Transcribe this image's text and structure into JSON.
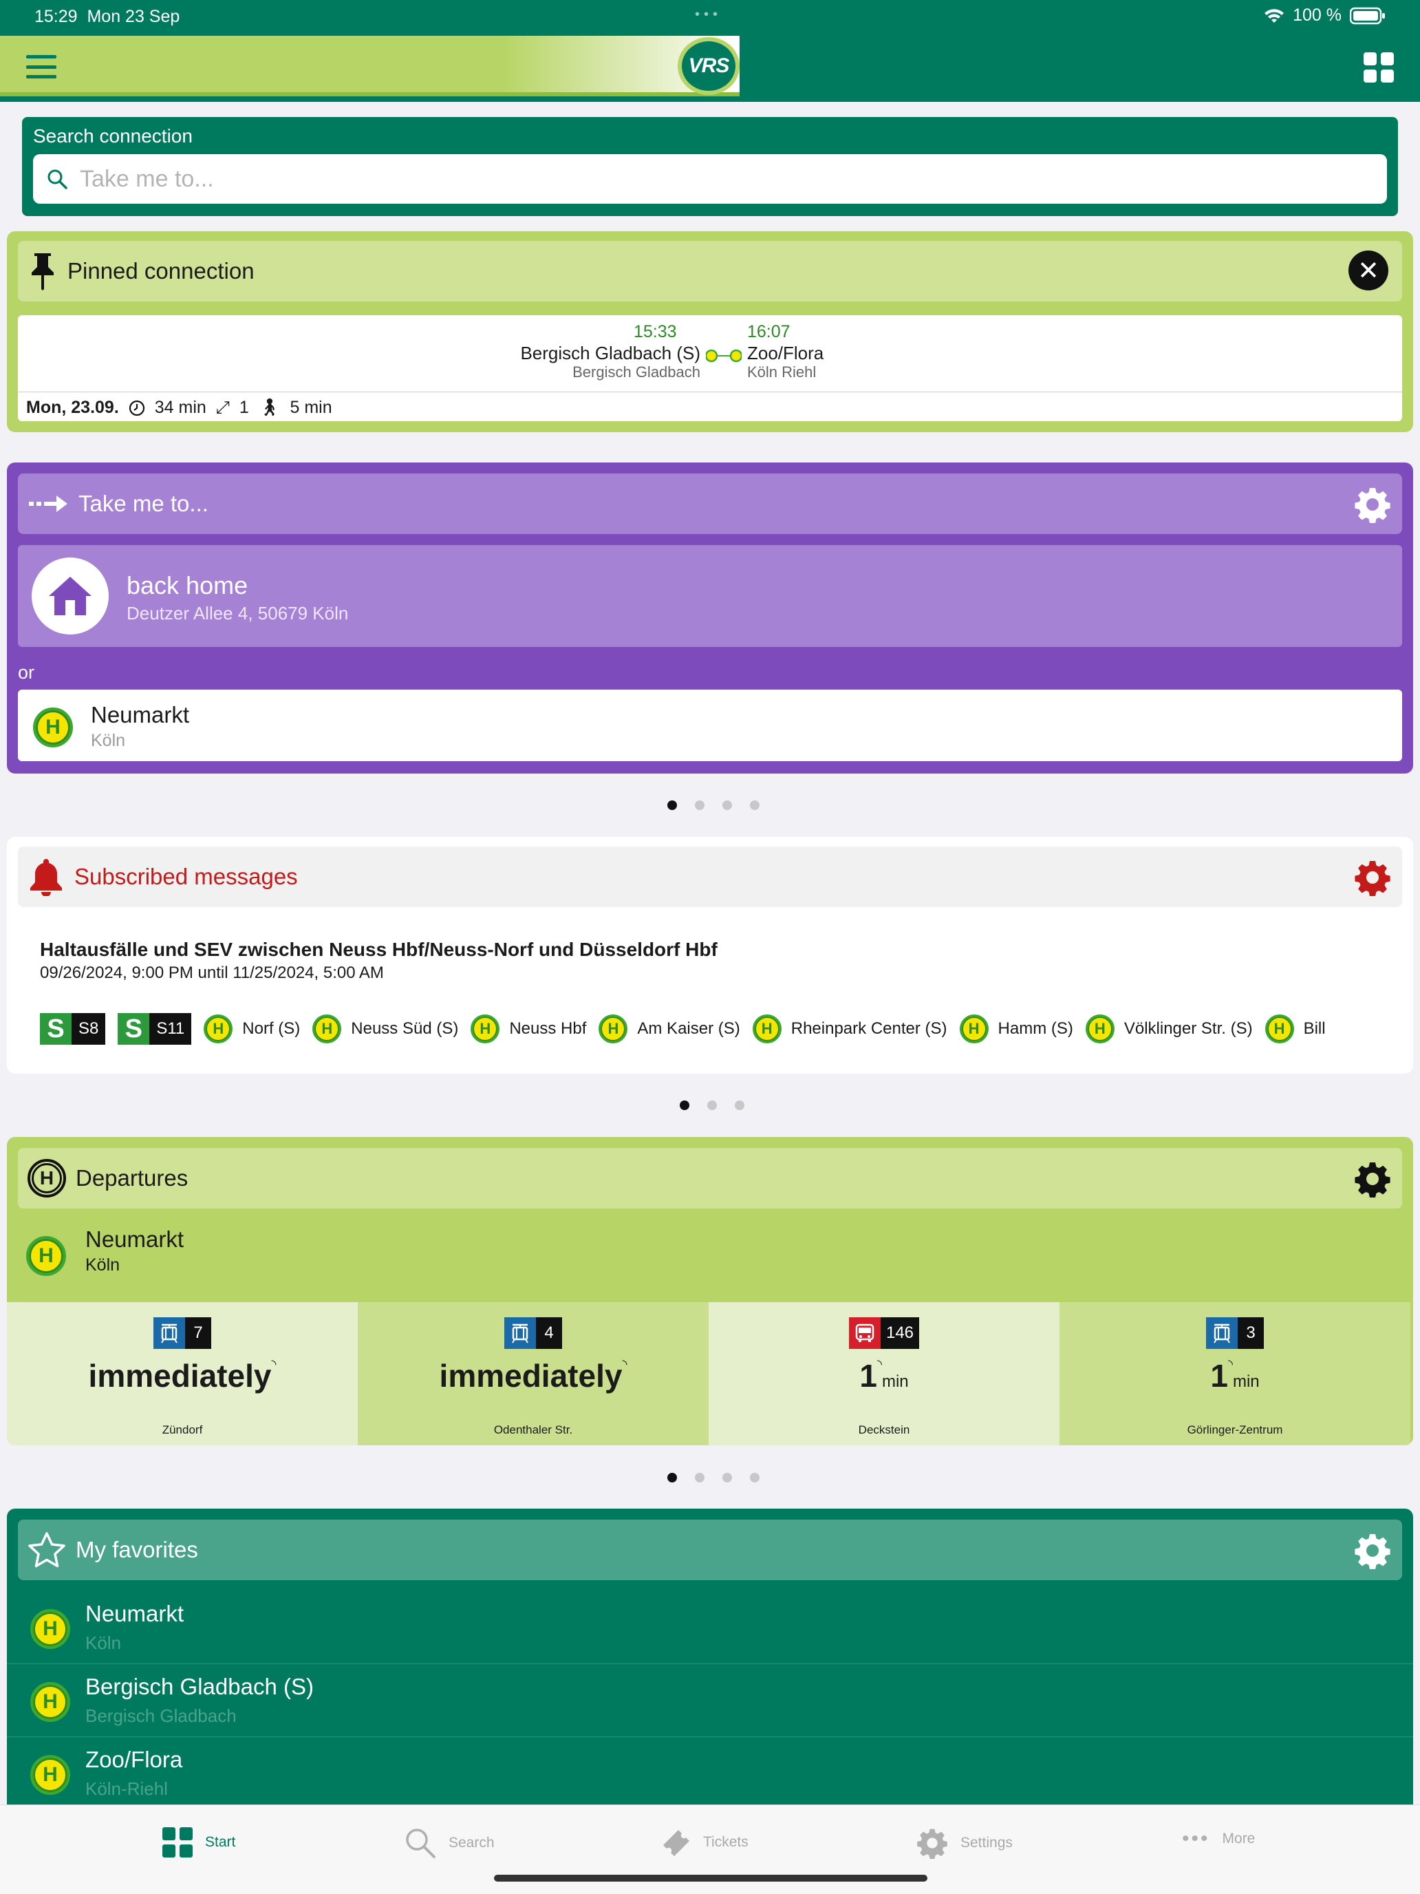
{
  "status_bar": {
    "time": "15:29",
    "date": "Mon 23 Sep",
    "battery": "100 %"
  },
  "header": {
    "logo": "VRS"
  },
  "search": {
    "label": "Search connection",
    "placeholder": "Take me to..."
  },
  "pinned": {
    "title": "Pinned connection",
    "dep_time": "15:33",
    "arr_time": "16:07",
    "from_name": "Bergisch Gladbach (S)",
    "from_sub": "Bergisch Gladbach",
    "to_name": "Zoo/Flora",
    "to_sub": "Köln Riehl",
    "date": "Mon, 23.09.",
    "duration": "34 min",
    "changes": "1",
    "walk": "5 min"
  },
  "take_me": {
    "title": "Take me to...",
    "home_name": "back home",
    "home_address": "Deutzer Allee 4, 50679 Köln",
    "or_label": "or",
    "stop_name": "Neumarkt",
    "stop_sub": "Köln",
    "page_count": 4,
    "active_page": 0
  },
  "messages": {
    "title": "Subscribed messages",
    "headline": "Haltausfälle und SEV zwischen Neuss Hbf/Neuss-Norf  und Düsseldorf Hbf",
    "period": "09/26/2024, 9:00 PM until 11/25/2024, 5:00 AM",
    "lines": [
      {
        "type": "S",
        "number": "S8"
      },
      {
        "type": "S",
        "number": "S11"
      }
    ],
    "stops": [
      "Norf (S)",
      "Neuss Süd (S)",
      "Neuss Hbf",
      "Am Kaiser (S)",
      "Rheinpark Center (S)",
      "Hamm (S)",
      "Völklinger Str. (S)",
      "Bill"
    ],
    "page_count": 3,
    "active_page": 0
  },
  "departures": {
    "title": "Departures",
    "stop_name": "Neumarkt",
    "stop_sub": "Köln",
    "items": [
      {
        "mode": "tram",
        "line": "7",
        "time": "immediately",
        "unit": "",
        "destination": "Zündorf"
      },
      {
        "mode": "tram",
        "line": "4",
        "time": "immediately",
        "unit": "",
        "destination": "Odenthaler Str."
      },
      {
        "mode": "bus",
        "line": "146",
        "time": "1",
        "unit": "min",
        "destination": "Deckstein"
      },
      {
        "mode": "tram",
        "line": "3",
        "time": "1",
        "unit": "min",
        "destination": "Görlinger-Zentrum"
      }
    ],
    "page_count": 4,
    "active_page": 0
  },
  "favorites": {
    "title": "My favorites",
    "items": [
      {
        "name": "Neumarkt",
        "sub": "Köln"
      },
      {
        "name": "Bergisch Gladbach (S)",
        "sub": "Bergisch Gladbach"
      },
      {
        "name": "Zoo/Flora",
        "sub": "Köln-Riehl"
      }
    ]
  },
  "tabbar": {
    "start": "Start",
    "search": "Search",
    "tickets": "Tickets",
    "settings": "Settings",
    "more": "More"
  },
  "colors": {
    "primary": "#007a5e",
    "lime": "#b7d566",
    "purple": "#7e4bbd",
    "alert": "#c41a1a"
  }
}
